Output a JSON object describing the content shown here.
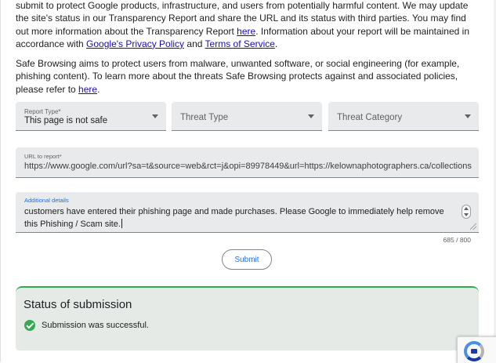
{
  "intro": {
    "p1_text1": "submit to protect Google products, infrastructure, and users from potentially harmful content. We may update the site's status in our Transparency Report and share the URL and its status with third parties. You may find out more information about the Transparency Report ",
    "p1_link_here": "here",
    "p1_text2": ". Information about your report will be maintained in accordance with ",
    "p1_link_privacy": "Google's Privacy Policy",
    "p1_text3": " and ",
    "p1_link_terms": "Terms of Service",
    "p1_text4": ".",
    "p2_text1": "Safe Browsing aims to protect users from malware, unwanted software, or social engineering (for example, phishing content). To learn more about the threats Safe Browsing protects against and associated policies, please refer to ",
    "p2_link_here": "here",
    "p2_text2": "."
  },
  "form": {
    "report_type": {
      "label": "Report Type*",
      "value": "This page is not safe"
    },
    "threat_type": {
      "placeholder": "Threat Type"
    },
    "threat_category": {
      "placeholder": "Threat Category"
    },
    "url": {
      "label": "URL to report*",
      "value": "https://www.google.com/url?sa=t&source=web&rct=j&opi=89978449&url=https://kelownaphotographers.ca/collections"
    },
    "details": {
      "label": "Additional details",
      "value": "customers have entered their phishing page and made purchases. Please Google to immediately help remove this Phishing / Scam site."
    },
    "counter": "685 / 800",
    "submit_label": "Submit"
  },
  "status": {
    "title": "Status of submission",
    "message": "Submission was successful.",
    "color": "#34a853"
  },
  "icons": {
    "success": "check-circle-icon",
    "dropdown": "caret-down-icon",
    "spinner": "number-spinner-icon",
    "recaptcha": "recaptcha-logo-icon"
  }
}
